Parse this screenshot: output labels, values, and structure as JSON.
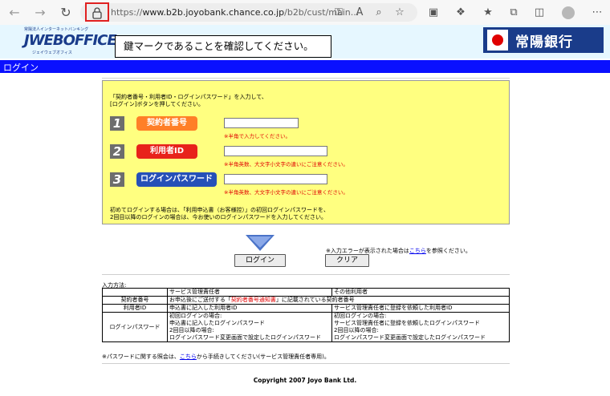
{
  "browser": {
    "url_prefix": "https://",
    "url_host": "www.b2b.joyobank.chance.co.jp",
    "url_rest": "/b2b/cust/main..."
  },
  "header": {
    "logo_small": "常陽法人インターネットバンキング",
    "logo_text": "JWEBOFFICE",
    "logo_sub": "ジェイウェブオフィス",
    "callout": "鍵マークであることを確認してください。",
    "bank_name": "常陽銀行"
  },
  "page": {
    "title": "ログイン"
  },
  "login": {
    "instruction_line1": "「契約者番号・利用者ID・ログインパスワード」を入力して、",
    "instruction_line2": "[ログイン]ボタンを押してください。",
    "fields": [
      {
        "number": "1",
        "label": "契約者番号",
        "note": "※半角で入力してください。"
      },
      {
        "number": "2",
        "label": "利用者ID",
        "note": "※半角英数、大文字小文字の違いにご注意ください。"
      },
      {
        "number": "3",
        "label": "ログインパスワード",
        "note": "※半角英数、大文字小文字の違いにご注意ください。"
      }
    ],
    "first_time_line1": "初めてログインする場合は、「利用申込書（お客様控）」の初回ログインパスワードを、",
    "first_time_line2": "2回目以降のログインの場合は、今お使いのログインパスワードを入力してください。"
  },
  "buttons": {
    "login": "ログイン",
    "clear": "クリア"
  },
  "error_note": {
    "prefix": "※入力エラーが表示された場合は",
    "link": "こちら",
    "suffix": "を参照ください。"
  },
  "method": {
    "title": "入力方法:",
    "header_admin": "サービス管理責任者",
    "header_other": "その他利用者",
    "row1_label": "契約者番号",
    "row1_pre": "お申込後にご送付する「",
    "row1_red": "契約者番号通知書",
    "row1_post": "」に記載されている契約者番号",
    "row2_label": "利用者ID",
    "row2_admin": "申込書に記入した利用者ID",
    "row2_other": "サービス管理責任者に登録を依頼した利用者ID",
    "row3_label": "ログインパスワード",
    "row3_admin_l1": "初回ログインの場合:",
    "row3_admin_l2": "申込書に記入したログインパスワード",
    "row3_admin_l3": "2回目以降の場合:",
    "row3_admin_l4": "ログインパスワード変更画面で設定したログインパスワード",
    "row3_other_l1": "初回ログインの場合:",
    "row3_other_l2": "サービス管理責任者に登録を依頼したログインパスワード",
    "row3_other_l3": "2回目以降の場合:",
    "row3_other_l4": "ログインパスワード変更画面で設定したログインパスワード"
  },
  "pw_note": {
    "prefix": "※パスワードに関する照会は、",
    "link": "こちら",
    "suffix": "から手続きしてください(サービス管理責任者専用)。"
  },
  "footer": {
    "copyright": "Copyright 2007 Joyo Bank Ltd."
  },
  "colors": {
    "title_bar": "#0a10ff",
    "panel_bg": "#ffff80",
    "label_1": "#ff7f27",
    "label_2": "#e8221b",
    "label_3": "#2650b8",
    "callout_border": "#e02020"
  },
  "icons": [
    "back-arrow-icon",
    "forward-arrow-icon",
    "reload-icon",
    "lock-icon",
    "key-icon",
    "read-aloud-icon",
    "zoom-icon",
    "favorite-star-icon",
    "extension-icon",
    "puzzle-icon",
    "favorites-icon",
    "collections-icon",
    "browser-tab-icon",
    "profile-icon",
    "more-icon",
    "down-arrow-icon"
  ]
}
